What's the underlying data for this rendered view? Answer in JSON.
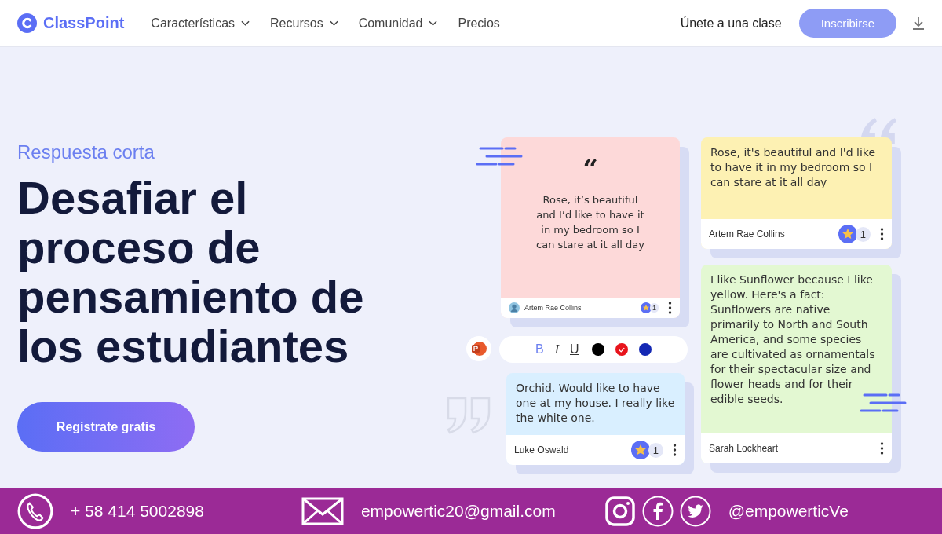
{
  "nav": {
    "logo": "ClassPoint",
    "items": [
      {
        "label": "Características",
        "dropdown": true
      },
      {
        "label": "Recursos",
        "dropdown": true
      },
      {
        "label": "Comunidad",
        "dropdown": true
      },
      {
        "label": "Precios",
        "dropdown": false
      }
    ],
    "join": "Únete a una clase",
    "signup": "Inscribirse"
  },
  "hero": {
    "eyebrow": "Respuesta corta",
    "title": "Desafiar el proceso de pensamiento de los estudiantes",
    "cta": "Registrate gratis"
  },
  "cards": [
    {
      "kind": "centered",
      "color": "#fdd9d9",
      "quote": "“",
      "text": "Rose, it’s beautiful and I’d like to have it in my bedroom so I can stare at it all day",
      "author": "Artem Rae Collins",
      "avatar": true,
      "likes": "1"
    },
    {
      "kind": "plain",
      "color": "#d9efff",
      "text": "Orchid. Would like to have one at my house. I really like the white one.",
      "author": "Luke Oswald",
      "avatar": false,
      "likes": "1"
    },
    {
      "kind": "plain",
      "color": "#fdf1b3",
      "text": "Rose, it's beautiful and I'd like to have it in my bedroom so I can stare at it all day",
      "author": "Artem Rae Collins",
      "avatar": false,
      "likes": "1"
    },
    {
      "kind": "plain",
      "color": "#e3f8d2",
      "text": "I like Sunflower because I like yellow. Here's a fact: Sunflowers are native primarily to North and South America, and some species are cultivated as ornamentals for their spectacular size and flower heads and for their edible seeds.",
      "author": "Sarah Lockheart",
      "avatar": false
    }
  ],
  "toolbar": {
    "formats": [
      {
        "label": "B",
        "kind": "bold"
      },
      {
        "label": "I",
        "kind": "italic"
      },
      {
        "label": "U",
        "kind": "underline"
      }
    ],
    "colors": [
      {
        "color": "#000000",
        "selected": false
      },
      {
        "color": "#e8141c",
        "selected": true
      },
      {
        "color": "#1428b4",
        "selected": false
      }
    ]
  },
  "footer": {
    "phone": "+ 58 414 5002898",
    "email": "empowertic20@gmail.com",
    "handle": "@empowerticVe"
  }
}
